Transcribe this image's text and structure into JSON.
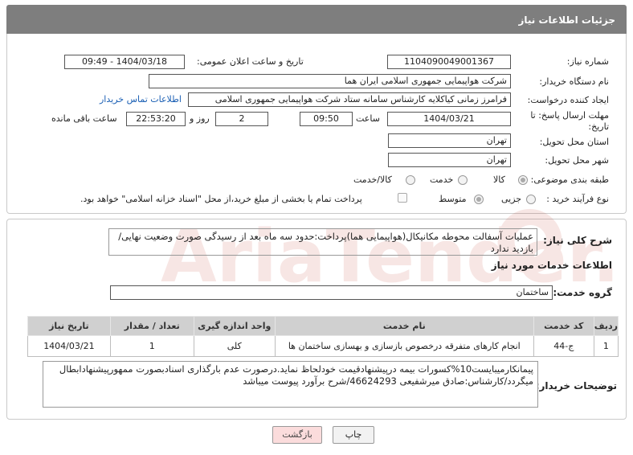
{
  "header": {
    "title": "جزئیات اطلاعات نیاز"
  },
  "form": {
    "need_number": {
      "label": "شماره نیاز:",
      "value": "1104090049001367"
    },
    "announce": {
      "label": "تاریخ و ساعت اعلان عمومی:",
      "value": "1404/03/18 - 09:49"
    },
    "buyer": {
      "label": "نام دستگاه خریدار:",
      "value": "شرکت هواپیمایی جمهوری اسلامی ایران هما"
    },
    "creator": {
      "label": "ایجاد کننده درخواست:",
      "value": "فرامرز زمانی کیاکلایه کارشناس سامانه ستاد شرکت هواپیمایی جمهوری اسلامی",
      "contact_link": "اطلاعات تماس خریدار"
    },
    "deadline": {
      "label": "مهلت ارسال پاسخ: تا تاریخ:",
      "date": "1404/03/21",
      "time_label": "ساعت",
      "time": "09:50",
      "days": "2",
      "days_label": "روز و",
      "remaining": "22:53:20",
      "remaining_label": "ساعت باقی مانده"
    },
    "province": {
      "label": "استان محل تحویل:",
      "value": "تهران"
    },
    "city": {
      "label": "شهر محل تحویل:",
      "value": "تهران"
    },
    "category": {
      "label": "طبقه بندی موضوعی:",
      "options": [
        "کالا",
        "خدمت",
        "کالا/خدمت"
      ]
    },
    "process": {
      "label": "نوع فرآیند خرید :",
      "options": [
        "جزیی",
        "متوسط"
      ],
      "treasury_note": "پرداخت تمام یا بخشی از مبلغ خرید،از محل \"اسناد خزانه اسلامی\" خواهد بود."
    }
  },
  "description": {
    "label": "شرح کلی نیاز:",
    "text": "عملیات آسفالت محوطه مکانیکال(هواپیمایی هما)پرداخت:حدود سه ماه بعد از رسیدگی صورت وضعیت نهایی/بازدید ندارد"
  },
  "services": {
    "title": "اطلاعات خدمات مورد نیاز",
    "group_label": "گروه خدمت:",
    "group_value": "ساختمان",
    "table": {
      "headers": [
        "ردیف",
        "کد خدمت",
        "نام خدمت",
        "واحد اندازه گیری",
        "تعداد / مقدار",
        "تاریخ نیاز"
      ],
      "rows": [
        [
          "1",
          "ج-44",
          "انجام کارهای متفرقه درخصوص بازسازی و بهسازی ساختمان ها",
          "کلی",
          "1",
          "1404/03/21"
        ]
      ]
    }
  },
  "buyer_notes": {
    "label": "توضیحات خریدار:",
    "text": "پیمانکارمیبایست10%کسورات بیمه درپیشنهادقیمت خودلحاظ نماید.درصورت عدم بارگذاری اسنادبصورت ممهورپیشنهادابطال میگردد/کارشناس:صادق میرشفیعی 46624293/شرح برآورد پیوست میباشد"
  },
  "buttons": {
    "print": "چاپ",
    "back": "بازگشت"
  },
  "watermark": {
    "text": "AriaTender.neT"
  }
}
